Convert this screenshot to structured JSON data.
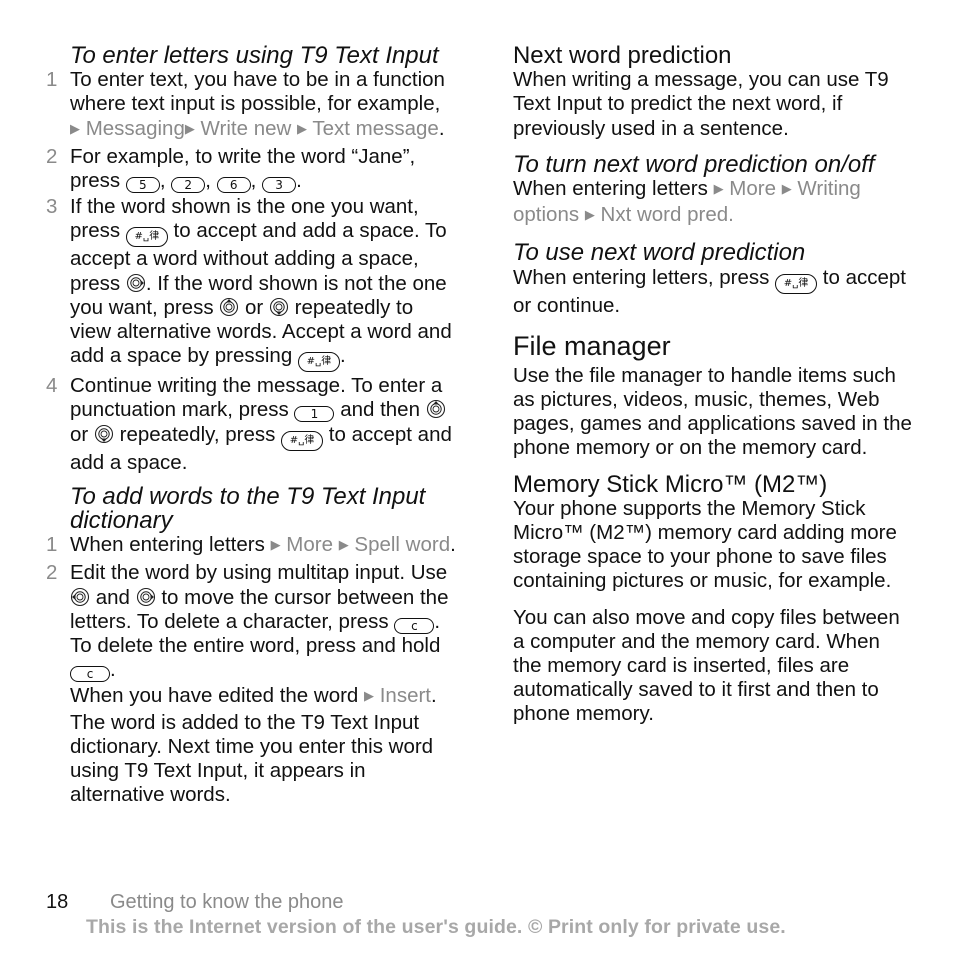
{
  "left": {
    "heading1": "To enter letters using T9 Text Input",
    "steps1": [
      {
        "num": "1",
        "text_a": "To enter text, you have to be in a function where text input is possible, for example,",
        "menu": [
          "Messaging",
          "Write new",
          "Text message"
        ]
      },
      {
        "num": "2",
        "text_a": "For example, to write the word “Jane”, press",
        "keys": [
          "5",
          "2",
          "6",
          "3"
        ]
      },
      {
        "num": "3",
        "text_a": "If the word shown is the one you want, press",
        "text_b": "to accept and add a space. To accept a word without adding a space, press",
        "text_c": ". If the word shown is not the one you want, press",
        "text_d": "or",
        "text_e": "repeatedly to view alternative words. Accept a word and add a space by pressing",
        "text_f": "."
      },
      {
        "num": "4",
        "text_a": "Continue writing the message. To enter a punctuation mark, press",
        "key": "1",
        "text_b": "and then",
        "text_c": "or",
        "text_d": "repeatedly, press",
        "text_e": "to accept and add a space."
      }
    ],
    "heading2": "To add words to the T9 Text Input dictionary",
    "steps2": [
      {
        "num": "1",
        "text_a": "When entering letters",
        "menu": [
          "More",
          "Spell word"
        ],
        "text_b": "."
      },
      {
        "num": "2",
        "text_a": "Edit the word by using multitap input. Use",
        "text_b": "and",
        "text_c": "to move the cursor between the letters. To delete a character, press",
        "key": "c",
        "text_d": ". To delete the entire word, press and hold",
        "text_e": ".",
        "text_f": "When you have edited the word",
        "menu": [
          "Insert"
        ],
        "text_g": ". The word is added to the T9 Text Input dictionary. Next time you enter this word using T9 Text Input, it appears in alternative words."
      }
    ]
  },
  "right": {
    "sub1": "Next word prediction",
    "para1": "When writing a message, you can use T9 Text Input to predict the next word, if previously used in a sentence.",
    "heading_onoff": "To turn next word prediction on/off",
    "onoff_text": "When entering letters",
    "onoff_menu": [
      "More",
      "Writing options",
      "Nxt word pred."
    ],
    "heading_use": "To use next word prediction",
    "use_text_a": "When entering letters, press",
    "use_text_b": "to accept or continue.",
    "section_title": "File manager",
    "fm_para": "Use the file manager to handle items such as pictures, videos, music, themes, Web pages, games and applications saved in the phone memory or on the memory card.",
    "sub2": "Memory Stick Micro™ (M2™)",
    "ms_para1": "Your phone supports the Memory Stick Micro™ (M2™) memory card adding more storage space to your phone to save files containing pictures or music, for example.",
    "ms_para2": "You can also move and copy files between a computer and the memory card. When the memory card is inserted, files are automatically saved to it first and then to phone memory."
  },
  "keys": {
    "hash_key_label": "#␣律",
    "triangle": "▶"
  },
  "footer": {
    "page_number": "18",
    "section": "Getting to know the phone",
    "notice": "This is the Internet version of the user's guide. © Print only for private use."
  },
  "colors": {
    "text": "#111111",
    "menu_grey": "#8a8a8a",
    "notice_grey": "#a8a8a8"
  }
}
